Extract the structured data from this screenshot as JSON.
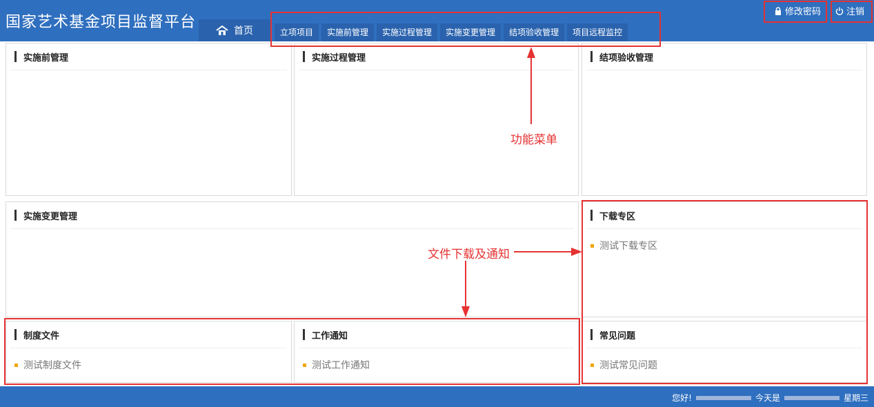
{
  "header": {
    "title": "国家艺术基金项目监督平台",
    "home_label": "首页",
    "nav": [
      "立项项目",
      "实施前管理",
      "实施过程管理",
      "实施变更管理",
      "结项验收管理",
      "项目远程监控"
    ],
    "change_password_label": "修改密码",
    "logout_label": "注销"
  },
  "panels": {
    "pre": {
      "title": "实施前管理"
    },
    "process": {
      "title": "实施过程管理"
    },
    "closing": {
      "title": "结项验收管理"
    },
    "change": {
      "title": "实施变更管理"
    },
    "download": {
      "title": "下载专区",
      "items": [
        "测试下载专区"
      ]
    },
    "rules": {
      "title": "制度文件",
      "items": [
        "测试制度文件"
      ]
    },
    "notice": {
      "title": "工作通知",
      "items": [
        "测试工作通知"
      ]
    },
    "faq": {
      "title": "常见问题",
      "items": [
        "测试常见问题"
      ]
    }
  },
  "annotations": {
    "menu": "功能菜单",
    "files": "文件下载及通知"
  },
  "footer": {
    "greeting": "您好!",
    "today": "今天是",
    "weekday": "星期三"
  },
  "colors": {
    "primary": "#2f6fbf",
    "annotation": "#e63232",
    "bullet": "#f0a500"
  },
  "icons": [
    "home-icon",
    "lock-icon",
    "power-icon"
  ]
}
